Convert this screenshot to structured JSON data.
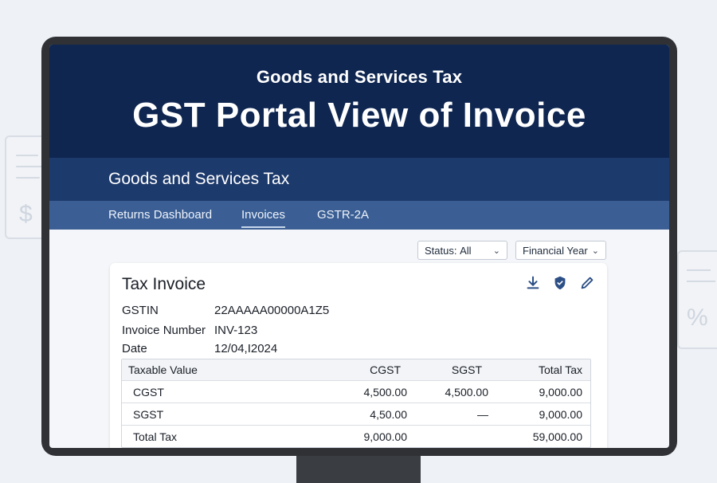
{
  "hero": {
    "supertitle": "Goods and Services Tax",
    "title": "GST Portal View of Invoice"
  },
  "subheader": {
    "title": "Goods and Services Tax"
  },
  "nav": {
    "items": [
      "Returns Dashboard",
      "Invoices",
      "GSTR-2A"
    ],
    "active": "Invoices"
  },
  "filters": {
    "status_label": "Status:",
    "status_value": "All",
    "year_label": "Financial Year"
  },
  "invoice": {
    "title": "Tax Invoice",
    "fields": [
      {
        "label": "GSTIN",
        "value": "22AAAAA00000A1Z5"
      },
      {
        "label": "Invoice Number",
        "value": "INV-123"
      },
      {
        "label": "Date",
        "value": "12/04,I2024"
      }
    ],
    "actions": [
      "download-icon",
      "shield-icon",
      "pencil-icon"
    ],
    "table": {
      "headers": [
        "Taxable Value",
        "CGST",
        "SGST",
        "Total Tax"
      ],
      "rows": [
        [
          "CGST",
          "4,500.00",
          "4,500.00",
          "9,000.00"
        ],
        [
          "SGST",
          "4,50.00",
          "—",
          "9,000.00"
        ],
        [
          "Total Tax",
          "9,000.00",
          "",
          "59,000.00"
        ]
      ]
    }
  },
  "colors": {
    "hero_bg": "#0f2651",
    "subheader_bg": "#1d3a6c",
    "nav_bg": "#3b5f94",
    "icon_accent": "#2c4f86"
  }
}
